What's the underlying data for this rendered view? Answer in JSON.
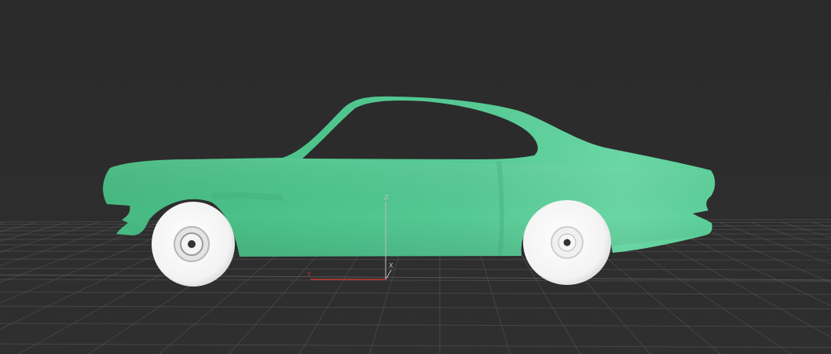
{
  "viewport": {
    "model": "car-body",
    "background_color": "#2b2b2b",
    "grid_color": "#5a5a5a",
    "body_color": "#4cc38a",
    "wheel_color": "#f2f2f2"
  },
  "gizmo": {
    "z_label": "Z",
    "x_label": "X",
    "y_label": "Y",
    "x_color": "#c0392b"
  }
}
